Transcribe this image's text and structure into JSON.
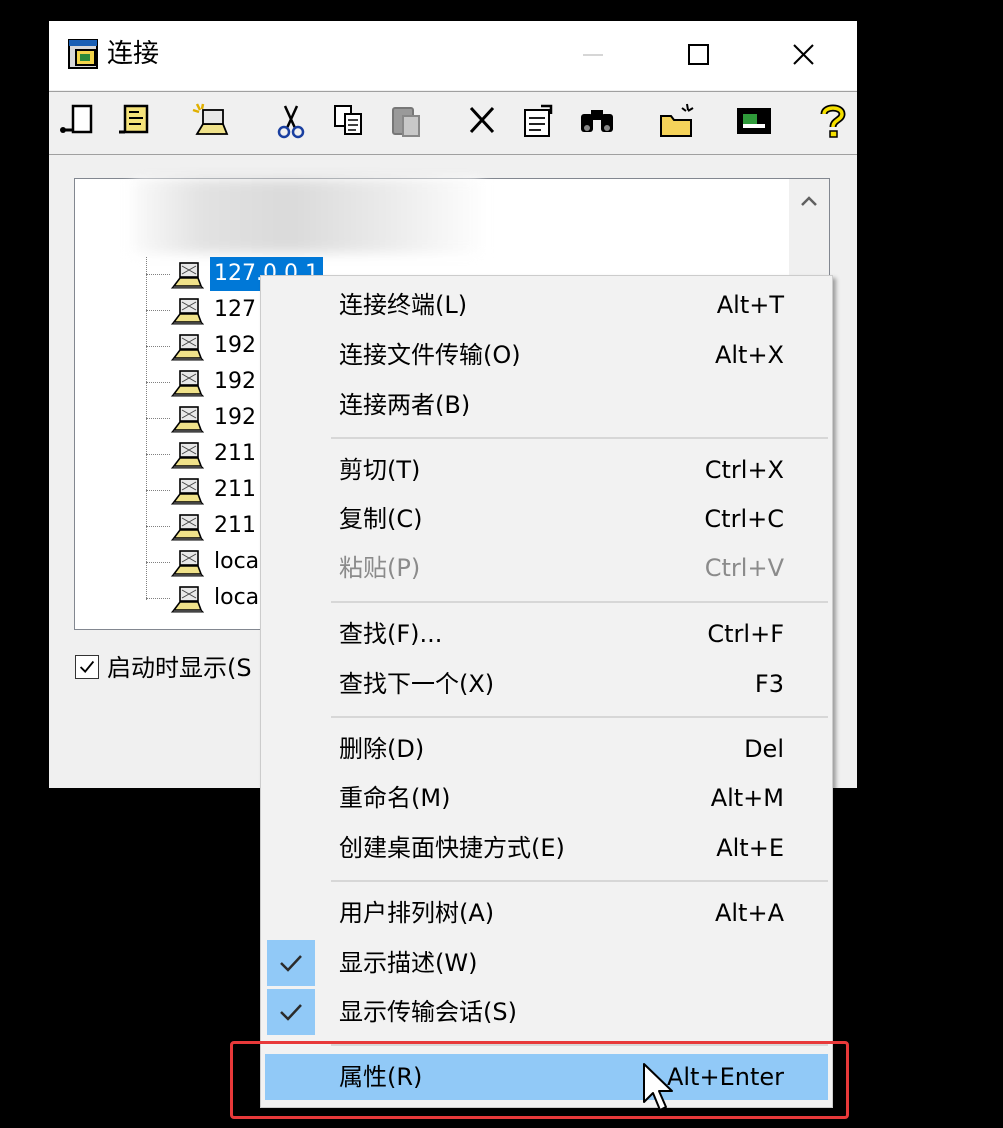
{
  "window": {
    "title": "连接",
    "title_icon": "connections-window-icon",
    "controls": [
      "minimize-icon",
      "maximize-icon",
      "close-icon"
    ]
  },
  "toolbar": {
    "buttons": [
      {
        "name": "connect-terminal-button",
        "icon": "connect-terminal-icon"
      },
      {
        "name": "connect-file-transfer-button",
        "icon": "connect-file-transfer-icon"
      },
      {
        "name": "new-session-button",
        "icon": "new-session-icon"
      },
      {
        "name": "cut-button",
        "icon": "scissors-icon"
      },
      {
        "name": "copy-button",
        "icon": "copy-icon"
      },
      {
        "name": "paste-button",
        "icon": "paste-icon",
        "disabled": true
      },
      {
        "name": "delete-button",
        "icon": "delete-x-icon"
      },
      {
        "name": "properties-button",
        "icon": "properties-icon"
      },
      {
        "name": "find-button",
        "icon": "binoculars-icon"
      },
      {
        "name": "new-folder-button",
        "icon": "new-folder-icon"
      },
      {
        "name": "desktop-shortcut-button",
        "icon": "monitor-icon"
      },
      {
        "name": "help-button",
        "icon": "help-question-icon"
      }
    ]
  },
  "tree": {
    "items": [
      {
        "label": "127.0.0.1",
        "selected": true
      },
      {
        "label": "127"
      },
      {
        "label": "192"
      },
      {
        "label": "192"
      },
      {
        "label": "192"
      },
      {
        "label": "211"
      },
      {
        "label": "211"
      },
      {
        "label": "211"
      },
      {
        "label": "loca"
      },
      {
        "label": "loca"
      }
    ]
  },
  "startup": {
    "label": "启动时显示(S",
    "checked": true
  },
  "context_menu": {
    "groups": [
      [
        {
          "label": "连接终端(L)",
          "shortcut": "Alt+T"
        },
        {
          "label": "连接文件传输(O)",
          "shortcut": "Alt+X"
        },
        {
          "label": "连接两者(B)",
          "shortcut": ""
        }
      ],
      [
        {
          "label": "剪切(T)",
          "shortcut": "Ctrl+X"
        },
        {
          "label": "复制(C)",
          "shortcut": "Ctrl+C"
        },
        {
          "label": "粘贴(P)",
          "shortcut": "Ctrl+V",
          "disabled": true
        }
      ],
      [
        {
          "label": "查找(F)...",
          "shortcut": "Ctrl+F"
        },
        {
          "label": "查找下一个(X)",
          "shortcut": "F3"
        }
      ],
      [
        {
          "label": "删除(D)",
          "shortcut": "Del"
        },
        {
          "label": "重命名(M)",
          "shortcut": "Alt+M"
        },
        {
          "label": "创建桌面快捷方式(E)",
          "shortcut": "Alt+E"
        }
      ],
      [
        {
          "label": "用户排列树(A)",
          "shortcut": "Alt+A"
        },
        {
          "label": "显示描述(W)",
          "shortcut": "",
          "checked": true
        },
        {
          "label": "显示传输会话(S)",
          "shortcut": "",
          "checked": true
        }
      ],
      [
        {
          "label": "属性(R)",
          "shortcut": "Alt+Enter",
          "highlighted": true
        }
      ]
    ]
  },
  "colors": {
    "selection": "#0078d7",
    "menu_highlight": "#91c9f7",
    "annotation_box": "#e8393a"
  }
}
